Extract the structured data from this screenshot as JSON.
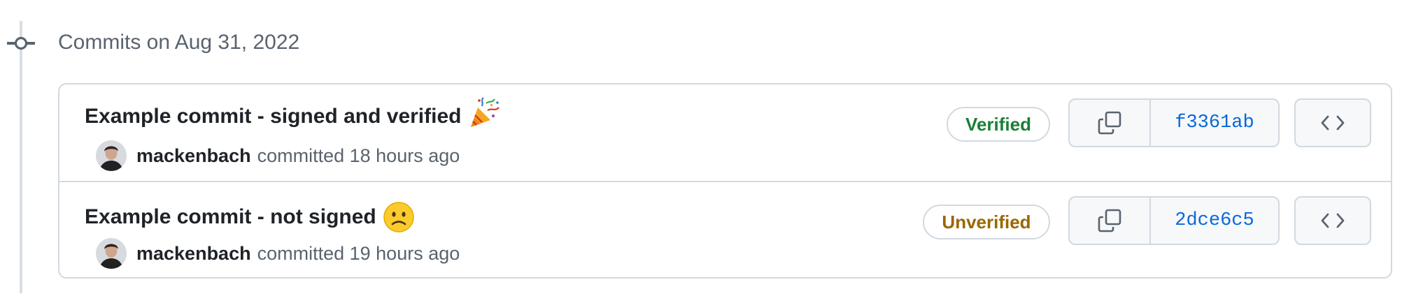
{
  "group": {
    "title": "Commits on Aug 31, 2022"
  },
  "commits": [
    {
      "title": "Example commit - signed and verified",
      "emoji": "party-popper",
      "author": "mackenbach",
      "committed_text": "committed 18 hours ago",
      "badge": "Verified",
      "badge_color": "#1a7f37",
      "sha": "f3361ab"
    },
    {
      "title": "Example commit - not signed",
      "emoji": "slightly-frowning-face",
      "author": "mackenbach",
      "committed_text": "committed 19 hours ago",
      "badge": "Unverified",
      "badge_color": "#9a6700",
      "sha": "2dce6c5"
    }
  ],
  "icons": {
    "timeline_node": "git-commit-icon",
    "copy": "copy-icon",
    "browse": "code-icon"
  },
  "colors": {
    "link": "#0969da",
    "muted_text": "#59636e",
    "border": "#d1d9e0",
    "button_bg": "#f6f8fa"
  }
}
